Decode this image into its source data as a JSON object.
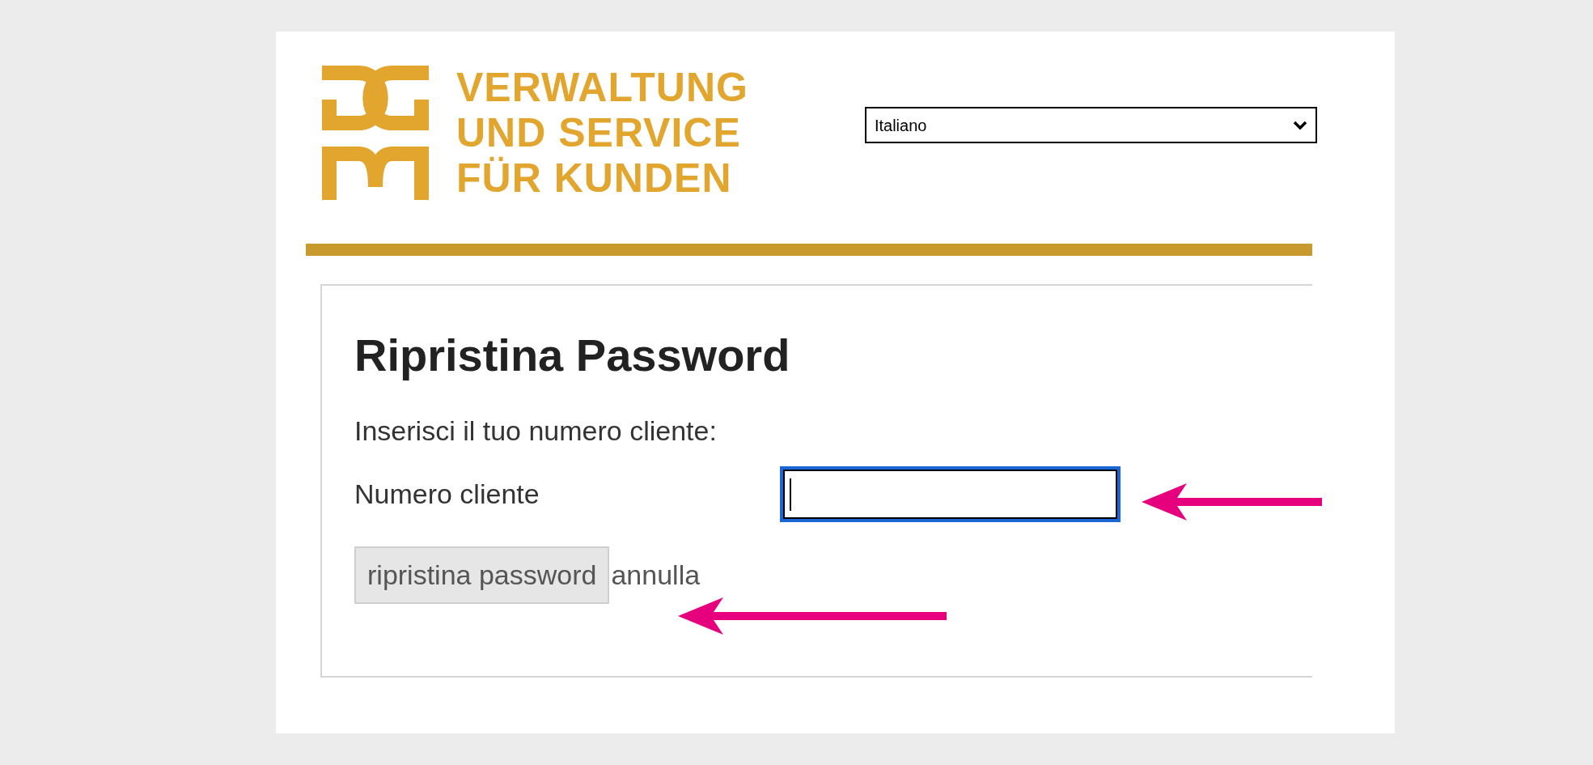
{
  "logo": {
    "lines": [
      "VERWALTUNG",
      "UND SERVICE",
      "FÜR KUNDEN"
    ]
  },
  "language_select": {
    "value": "Italiano"
  },
  "form": {
    "title": "Ripristina Password",
    "instruction": "Inserisci il tuo numero cliente:",
    "field": {
      "label": "Numero cliente",
      "focused": true
    },
    "buttons": [
      {
        "kind": "button",
        "label": "ripristina password"
      },
      {
        "kind": "link",
        "label": "annulla"
      }
    ]
  }
}
